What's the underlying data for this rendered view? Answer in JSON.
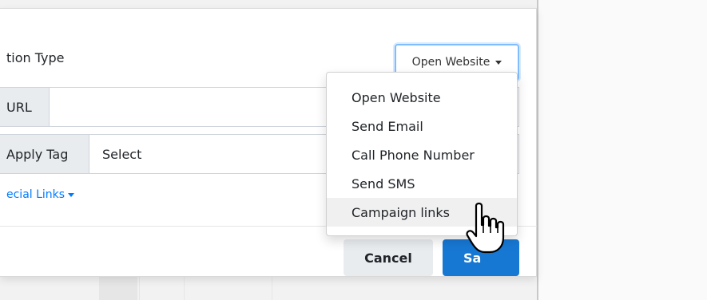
{
  "modal": {
    "action_type_label": "tion Type",
    "type_button_label": "Open Website",
    "url_addon": "URL",
    "url_value": "",
    "tag_addon": "Apply Tag",
    "tag_value": "Select",
    "special_links_label": "ecial Links",
    "cancel_label": "Cancel",
    "save_label": "Sa"
  },
  "dropdown": {
    "items": [
      {
        "label": "Open Website"
      },
      {
        "label": "Send Email"
      },
      {
        "label": "Call Phone Number"
      },
      {
        "label": "Send SMS"
      },
      {
        "label": "Campaign links"
      }
    ],
    "hovered_index": 4
  },
  "icons": {
    "cursor": "hand-pointer-icon"
  },
  "colors": {
    "primary": "#1778d4",
    "link": "#007bff",
    "focus_border": "#80bdff"
  }
}
